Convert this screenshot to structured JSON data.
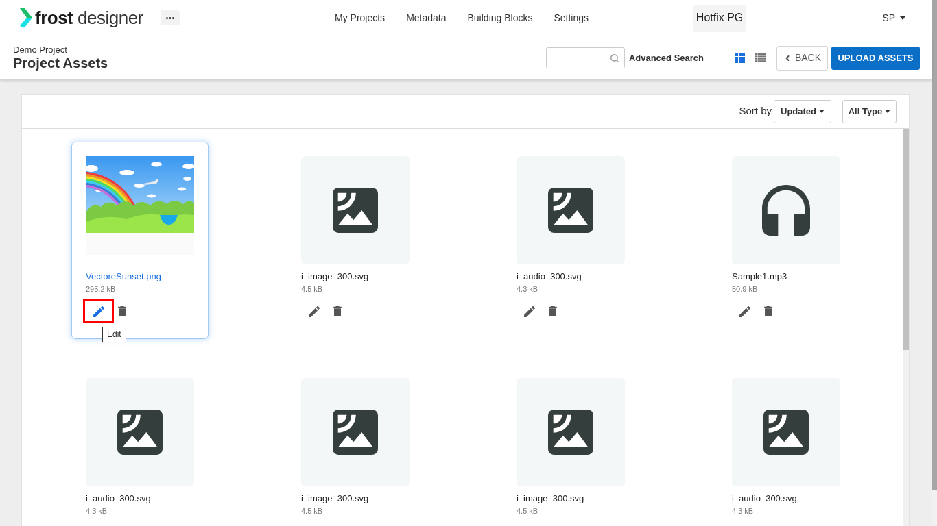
{
  "header": {
    "logo": {
      "bold": "frost",
      "light": "designer"
    },
    "nav_links": [
      "My Projects",
      "Metadata",
      "Building Blocks",
      "Settings"
    ],
    "project_switcher": "Hotfix PG",
    "user_menu": "SP"
  },
  "page_header": {
    "breadcrumb": "Demo Project",
    "title": "Project Assets",
    "advanced_search": "Advanced Search",
    "view_modes": [
      {
        "kind": "grid",
        "selected": true
      },
      {
        "kind": "list",
        "selected": false
      }
    ],
    "back_button": "BACK",
    "upload_button": "UPLOAD ASSETS"
  },
  "toolbar": {
    "sort_label": "Sort by",
    "sort_value": "Updated",
    "type_filter": "All Type"
  },
  "assets": [
    {
      "name": "VectoreSunset.png",
      "size": "295.2 kB",
      "kind": "photo",
      "selected": true,
      "actions": {
        "edit_highlighted": true,
        "tooltip": "Edit"
      }
    },
    {
      "name": "i_image_300.svg",
      "size": "4.5 kB",
      "kind": "image",
      "selected": false,
      "actions": {
        "edit_highlighted": false
      }
    },
    {
      "name": "i_audio_300.svg",
      "size": "4.3 kB",
      "kind": "image",
      "selected": false,
      "actions": {
        "edit_highlighted": false
      }
    },
    {
      "name": "Sample1.mp3",
      "size": "50.9 kB",
      "kind": "audio",
      "selected": false,
      "actions": {
        "edit_highlighted": false
      }
    },
    {
      "name": "i_audio_300.svg",
      "size": "4.3 kB",
      "kind": "image",
      "selected": false
    },
    {
      "name": "i_image_300.svg",
      "size": "4.5 kB",
      "kind": "image",
      "selected": false
    },
    {
      "name": "i_image_300.svg",
      "size": "4.5 kB",
      "kind": "image",
      "selected": false
    },
    {
      "name": "i_audio_300.svg",
      "size": "4.3 kB",
      "kind": "image",
      "selected": false
    }
  ]
}
